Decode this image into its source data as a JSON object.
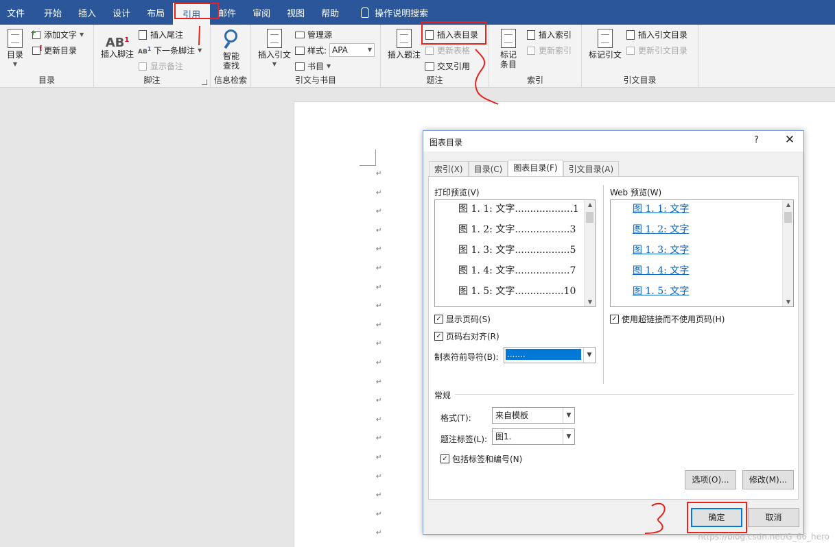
{
  "tabs": [
    "文件",
    "开始",
    "插入",
    "设计",
    "布局",
    "引用",
    "邮件",
    "审阅",
    "视图",
    "帮助"
  ],
  "active_tab_index": 5,
  "search_label": "操作说明搜索",
  "ribbon": {
    "toc": {
      "big": "目录",
      "add_text": "添加文字",
      "update": "更新目录",
      "label": "目录"
    },
    "footnotes": {
      "insert_footnote": "插入脚注",
      "insert_endnote": "插入尾注",
      "next_footnote": "下一条脚注",
      "show_notes": "显示备注",
      "label": "脚注"
    },
    "research": {
      "smart_lookup_1": "智能",
      "smart_lookup_2": "查找",
      "label": "信息检索"
    },
    "citations": {
      "insert_citation": "插入引文",
      "manage_sources": "管理源",
      "style_label": "样式:",
      "style_value": "APA",
      "bibliography": "书目",
      "label": "引文与书目"
    },
    "captions": {
      "insert_caption": "插入题注",
      "insert_table_of_figures": "插入表目录",
      "update_table": "更新表格",
      "cross_reference": "交叉引用",
      "label": "题注"
    },
    "index": {
      "mark_entry_1": "标记",
      "mark_entry_2": "条目",
      "insert_index": "插入索引",
      "update_index": "更新索引",
      "label": "索引"
    },
    "toa": {
      "mark_citation": "标记引文",
      "insert_toa": "插入引文目录",
      "update_toa": "更新引文目录",
      "label": "引文目录"
    }
  },
  "dialog": {
    "title": "图表目录",
    "help": "?",
    "close": "✕",
    "tabs": [
      "索引(X)",
      "目录(C)",
      "图表目录(F)",
      "引文目录(A)"
    ],
    "active_tab_index": 2,
    "print_preview_label": "打印预览(V)",
    "web_preview_label": "Web 预览(W)",
    "print_lines": [
      {
        "text": "图 1. 1: 文字",
        "dots": "...................",
        "page": "1"
      },
      {
        "text": "图 1. 2: 文字",
        "dots": "..................",
        "page": "3"
      },
      {
        "text": "图 1. 3: 文字",
        "dots": "..................",
        "page": "5"
      },
      {
        "text": "图 1. 4: 文字",
        "dots": "..................",
        "page": "7"
      },
      {
        "text": "图 1. 5: 文字",
        "dots": "................",
        "page": "10"
      }
    ],
    "web_lines": [
      "图 1. 1: 文字",
      "图 1. 2: 文字",
      "图 1. 3: 文字",
      "图 1. 4: 文字",
      "图 1. 5: 文字"
    ],
    "show_page_numbers": "显示页码(S)",
    "right_align": "页码右对齐(R)",
    "tab_leader_label": "制表符前导符(B):",
    "tab_leader_value": ".......",
    "use_hyperlinks": "使用超链接而不使用页码(H)",
    "general_label": "常规",
    "format_label": "格式(T):",
    "format_value": "来自模板",
    "caption_label_label": "题注标签(L):",
    "caption_label_value": "图1.",
    "include_label": "包括标签和编号(N)",
    "options_btn": "选项(O)...",
    "modify_btn": "修改(M)...",
    "ok_btn": "确定",
    "cancel_btn": "取消",
    "checked_mark": "✓"
  },
  "watermark": "https://blog.csdn.net/G_66_hero"
}
